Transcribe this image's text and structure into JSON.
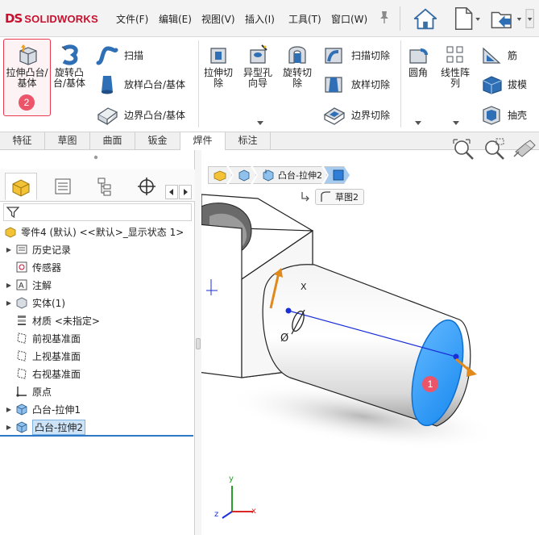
{
  "app": {
    "brand": "SOLIDWORKS",
    "brand_mark": "DS"
  },
  "menu": {
    "items": [
      "文件(F)",
      "编辑(E)",
      "视图(V)",
      "插入(I)",
      "工具(T)",
      "窗口(W)"
    ]
  },
  "quick_access": {
    "icons": [
      "home-icon",
      "new-document-icon",
      "open-icon"
    ]
  },
  "ribbon": {
    "extrude_boss": "拉伸凸台/基体",
    "revolve_boss": "旋转凸台/基体",
    "sweep": "扫描",
    "loft_boss": "放样凸台/基体",
    "boundary_boss": "边界凸台/基体",
    "extrude_cut": "拉伸切除",
    "hole_wizard": "异型孔向导",
    "revolve_cut": "旋转切除",
    "sweep_cut": "扫描切除",
    "loft_cut": "放样切除",
    "boundary_cut": "边界切除",
    "fillet": "圆角",
    "linear_pattern": "线性阵列",
    "rib": "筋",
    "draft": "拔模",
    "shell": "抽壳",
    "step_badge": "2"
  },
  "command_tabs": {
    "items": [
      "特征",
      "草图",
      "曲面",
      "钣金",
      "焊件",
      "标注"
    ],
    "active": "焊件"
  },
  "feature_tree": {
    "root": "零件4 (默认) <<默认>_显示状态 1>",
    "items": [
      {
        "label": "历史记录",
        "icon": "history-icon",
        "expandable": true
      },
      {
        "label": "传感器",
        "icon": "sensor-icon",
        "expandable": false
      },
      {
        "label": "注解",
        "icon": "annotation-icon",
        "expandable": true
      },
      {
        "label": "实体(1)",
        "icon": "solid-body-icon",
        "expandable": true
      },
      {
        "label": "材质 <未指定>",
        "icon": "material-icon",
        "expandable": false
      },
      {
        "label": "前视基准面",
        "icon": "plane-icon",
        "expandable": false
      },
      {
        "label": "上视基准面",
        "icon": "plane-icon",
        "expandable": false
      },
      {
        "label": "右视基准面",
        "icon": "plane-icon",
        "expandable": false
      },
      {
        "label": "原点",
        "icon": "origin-icon",
        "expandable": false
      },
      {
        "label": "凸台-拉伸1",
        "icon": "boss-extrude-icon",
        "expandable": true
      },
      {
        "label": "凸台-拉伸2",
        "icon": "boss-extrude-icon",
        "expandable": true,
        "selected": true
      }
    ]
  },
  "viewport": {
    "breadcrumb": [
      "凸台-拉伸2"
    ],
    "sketch_chip": "草图2",
    "axis_labels": {
      "x": "x",
      "y": "y",
      "z": "z",
      "part_x": "X"
    },
    "step_badge": "1",
    "dimension_symbol": "Ø",
    "colors": {
      "face_highlight": "#1e90ff",
      "arrow": "#e08a1e",
      "badge": "#ec5469"
    }
  }
}
